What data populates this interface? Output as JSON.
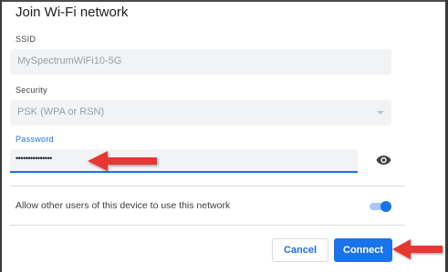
{
  "dialog": {
    "title": "Join Wi-Fi network"
  },
  "ssid": {
    "label": "SSID",
    "value": "MySpectrumWiFi10-5G"
  },
  "security": {
    "label": "Security",
    "value": "PSK (WPA or RSN)"
  },
  "password": {
    "label": "Password",
    "value": "•••••••••••••••"
  },
  "share": {
    "label": "Allow other users of this device to use this network",
    "enabled": true
  },
  "buttons": {
    "cancel": "Cancel",
    "connect": "Connect"
  },
  "colors": {
    "accent": "#1a73e8",
    "annotation_arrow": "#e53935",
    "field_background": "#f1f3f4"
  },
  "icons": {
    "password_visibility": "eye-icon",
    "security_dropdown": "dropdown-arrow-icon"
  }
}
